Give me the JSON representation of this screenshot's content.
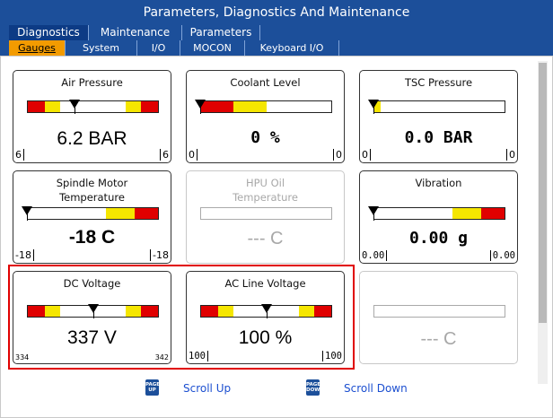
{
  "window": {
    "title": "Parameters, Diagnostics And Maintenance"
  },
  "tabs": [
    {
      "label": "Diagnostics",
      "active": true
    },
    {
      "label": "Maintenance",
      "active": false
    },
    {
      "label": "Parameters",
      "active": false
    }
  ],
  "subtabs": [
    {
      "label": "Gauges",
      "active": true
    },
    {
      "label": "System",
      "active": false
    },
    {
      "label": "I/O",
      "active": false
    },
    {
      "label": "MOCON",
      "active": false
    },
    {
      "label": "Keyboard I/O",
      "active": false
    }
  ],
  "colors": {
    "header": "#1c4f9a",
    "active_subtab": "#f39b00",
    "zone_red": "#e00000",
    "zone_yellow": "#f5e600",
    "highlight": "#e00000"
  },
  "gauges": [
    {
      "label": "Air Pressure",
      "value": "6.2 BAR",
      "min": "6",
      "max": "6",
      "pointer": 0.36,
      "zones": "rywyr",
      "enabled": true
    },
    {
      "label": "Coolant Level",
      "value": "0 %",
      "min": "0",
      "max": "0",
      "pointer": 0.0,
      "zones": "ryw",
      "enabled": true
    },
    {
      "label": "TSC Pressure",
      "value": "0.0 BAR",
      "min": "0",
      "max": "0",
      "pointer": 0.0,
      "zones": "yw",
      "enabled": true
    },
    {
      "label": "Spindle Motor Temperature",
      "value": "-18 C",
      "min": "-18",
      "max": "-18",
      "pointer": 0.0,
      "zones": "wyr",
      "enabled": true
    },
    {
      "label": "HPU Oil Temperature",
      "value": "--- C",
      "min": "",
      "max": "",
      "pointer": null,
      "zones": "",
      "enabled": false
    },
    {
      "label": "Vibration",
      "value": "0.00 g",
      "min": "0.00",
      "max": "0.00",
      "pointer": 0.0,
      "zones": "wyr",
      "enabled": true
    },
    {
      "label": "DC Voltage",
      "value": "337 V",
      "min": "334",
      "max": "342",
      "pointer": 0.5,
      "zones": "rywyr",
      "enabled": true
    },
    {
      "label": "AC Line Voltage",
      "value": "100 %",
      "min": "100",
      "max": "100",
      "pointer": 0.5,
      "zones": "rywyr",
      "enabled": true
    },
    {
      "label": "",
      "value": "--- C",
      "min": "",
      "max": "",
      "pointer": null,
      "zones": "",
      "enabled": false
    }
  ],
  "footer": {
    "page_up_key": "PAGE UP",
    "page_up_label": "Scroll Up",
    "page_down_key": "PAGE DOWN",
    "page_down_label": "Scroll Down"
  }
}
